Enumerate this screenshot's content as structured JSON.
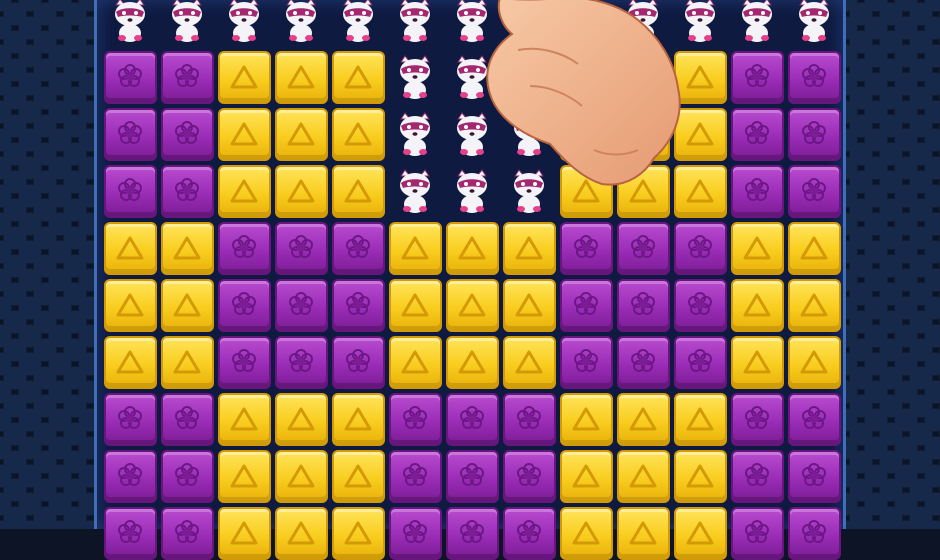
{
  "game": {
    "board": {
      "rows": [
        [
          "raccoon",
          "raccoon",
          "raccoon",
          "raccoon",
          "raccoon",
          "raccoon",
          "raccoon",
          "raccoon",
          "raccoon",
          "raccoon",
          "raccoon",
          "raccoon",
          "raccoon"
        ],
        [
          "purple",
          "purple",
          "yellow",
          "yellow",
          "yellow",
          "raccoon",
          "raccoon",
          "raccoon",
          "raccoon",
          "raccoon",
          "yellow",
          "purple",
          "purple"
        ],
        [
          "purple",
          "purple",
          "yellow",
          "yellow",
          "yellow",
          "raccoon",
          "raccoon",
          "raccoon",
          "yellow",
          "yellow",
          "yellow",
          "purple",
          "purple"
        ],
        [
          "purple",
          "purple",
          "yellow",
          "yellow",
          "yellow",
          "raccoon",
          "raccoon",
          "raccoon",
          "yellow",
          "yellow",
          "yellow",
          "purple",
          "purple"
        ],
        [
          "yellow",
          "yellow",
          "purple",
          "purple",
          "purple",
          "yellow",
          "yellow",
          "yellow",
          "purple",
          "purple",
          "purple",
          "yellow",
          "yellow"
        ],
        [
          "yellow",
          "yellow",
          "purple",
          "purple",
          "purple",
          "yellow",
          "yellow",
          "yellow",
          "purple",
          "purple",
          "purple",
          "yellow",
          "yellow"
        ],
        [
          "yellow",
          "yellow",
          "purple",
          "purple",
          "purple",
          "yellow",
          "yellow",
          "yellow",
          "purple",
          "purple",
          "purple",
          "yellow",
          "yellow"
        ],
        [
          "purple",
          "purple",
          "yellow",
          "yellow",
          "yellow",
          "purple",
          "purple",
          "purple",
          "yellow",
          "yellow",
          "yellow",
          "purple",
          "purple"
        ],
        [
          "purple",
          "purple",
          "yellow",
          "yellow",
          "yellow",
          "purple",
          "purple",
          "purple",
          "yellow",
          "yellow",
          "yellow",
          "purple",
          "purple"
        ],
        [
          "purple",
          "purple",
          "yellow",
          "yellow",
          "yellow",
          "purple",
          "purple",
          "purple",
          "yellow",
          "yellow",
          "yellow",
          "purple",
          "purple"
        ]
      ]
    },
    "tile_types": {
      "purple": {
        "icon": "flower-icon",
        "color": "#9a2cb6"
      },
      "yellow": {
        "icon": "triangle-icon",
        "color": "#f9cd1f"
      },
      "raccoon": {
        "icon": "raccoon-icon",
        "color": "#ffffff"
      }
    },
    "tutorial_pointer": {
      "icon": "hand-pointer-icon"
    }
  }
}
